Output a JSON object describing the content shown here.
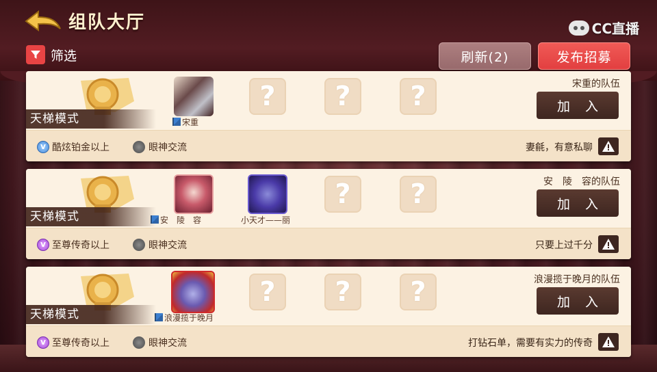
{
  "header": {
    "title": "组队大厅",
    "watermark": "CC直播"
  },
  "toolbar": {
    "filter_label": "筛选",
    "refresh_label": "刷新(2)",
    "publish_label": "发布招募"
  },
  "cards": [
    {
      "mode": "天梯模式",
      "members": [
        {
          "name": "宋重"
        }
      ],
      "team_name": "宋重的队伍",
      "join_label": "加 入",
      "rank": "酷炫铂金以上",
      "voice": "眼神交流",
      "note": "妻毹，有意私聊"
    },
    {
      "mode": "天梯模式",
      "members": [
        {
          "name": "安　陵　容"
        },
        {
          "name": "小天才——丽"
        }
      ],
      "team_name": "安　陵　容的队伍",
      "join_label": "加 入",
      "rank": "至尊传奇以上",
      "voice": "眼神交流",
      "note": "只要上过千分"
    },
    {
      "mode": "天梯模式",
      "members": [
        {
          "name": "浪漫揽于晚月"
        }
      ],
      "team_name": "浪漫揽于晚月的队伍",
      "join_label": "加 入",
      "rank": "至尊传奇以上",
      "voice": "眼神交流",
      "note": "打钻石单，需要有实力的传奇"
    }
  ],
  "placeholder_symbol": "?",
  "colors": {
    "publish": "#e23f40",
    "refresh": "#986a6c",
    "card_bg": "#fcf2e3",
    "join": "#3e2620"
  }
}
